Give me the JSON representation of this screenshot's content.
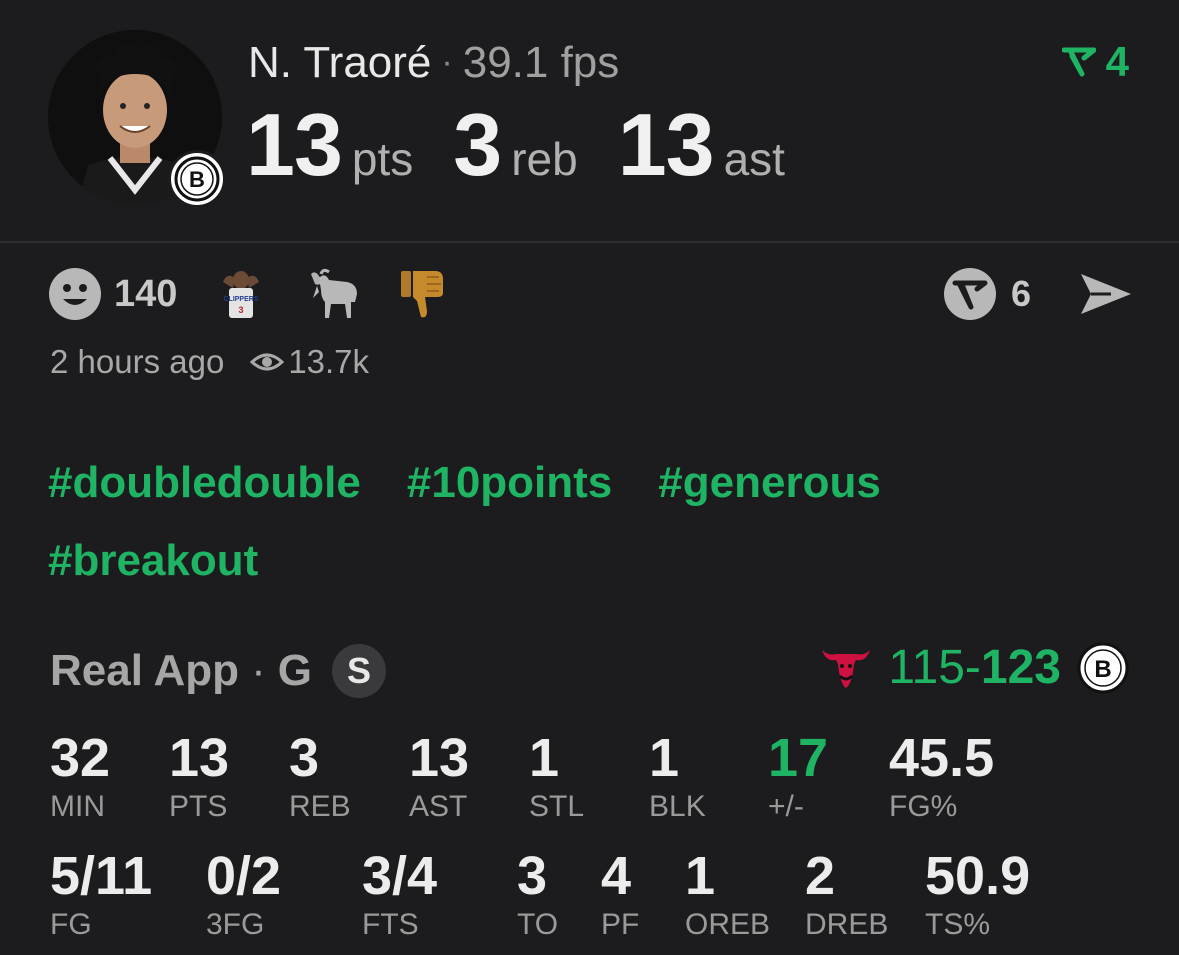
{
  "player": {
    "name": "N. Traoré",
    "separator": "·",
    "fps": "39.1 fps",
    "green_count": "4",
    "headline": [
      {
        "value": "13",
        "unit": "pts"
      },
      {
        "value": "3",
        "unit": "reb"
      },
      {
        "value": "13",
        "unit": "ast"
      }
    ]
  },
  "reactions": {
    "smiley_count": "140",
    "other_count": "6"
  },
  "meta": {
    "time": "2 hours ago",
    "views": "13.7k"
  },
  "hashtags": [
    "#doubledouble",
    "#10points",
    "#generous",
    "#breakout"
  ],
  "game": {
    "source": "Real App",
    "separator": "·",
    "position": "G",
    "badge": "S",
    "score_away": "115",
    "score_dash": "-",
    "score_home": "123"
  },
  "stats_row1": [
    {
      "value": "32",
      "label": "MIN"
    },
    {
      "value": "13",
      "label": "PTS"
    },
    {
      "value": "3",
      "label": "REB"
    },
    {
      "value": "13",
      "label": "AST"
    },
    {
      "value": "1",
      "label": "STL"
    },
    {
      "value": "1",
      "label": "BLK"
    },
    {
      "value": "17",
      "label": "+/-"
    },
    {
      "value": "45.5",
      "label": "FG%"
    }
  ],
  "stats_row2": [
    {
      "value": "5/11",
      "label": "FG"
    },
    {
      "value": "0/2",
      "label": "3FG"
    },
    {
      "value": "3/4",
      "label": "FTS"
    },
    {
      "value": "3",
      "label": "TO"
    },
    {
      "value": "4",
      "label": "PF"
    },
    {
      "value": "1",
      "label": "OREB"
    },
    {
      "value": "2",
      "label": "DREB"
    },
    {
      "value": "50.9",
      "label": "TS%"
    }
  ],
  "colors": {
    "accent_green": "#1fb364",
    "background": "#1c1c1e"
  },
  "icons": [
    "player-avatar",
    "nets-logo",
    "real-logo-icon",
    "smiley-icon",
    "player-reaction-icon",
    "goat-icon",
    "thumbs-down-icon",
    "comment-brand-icon",
    "send-icon",
    "eye-icon",
    "bulls-logo"
  ]
}
